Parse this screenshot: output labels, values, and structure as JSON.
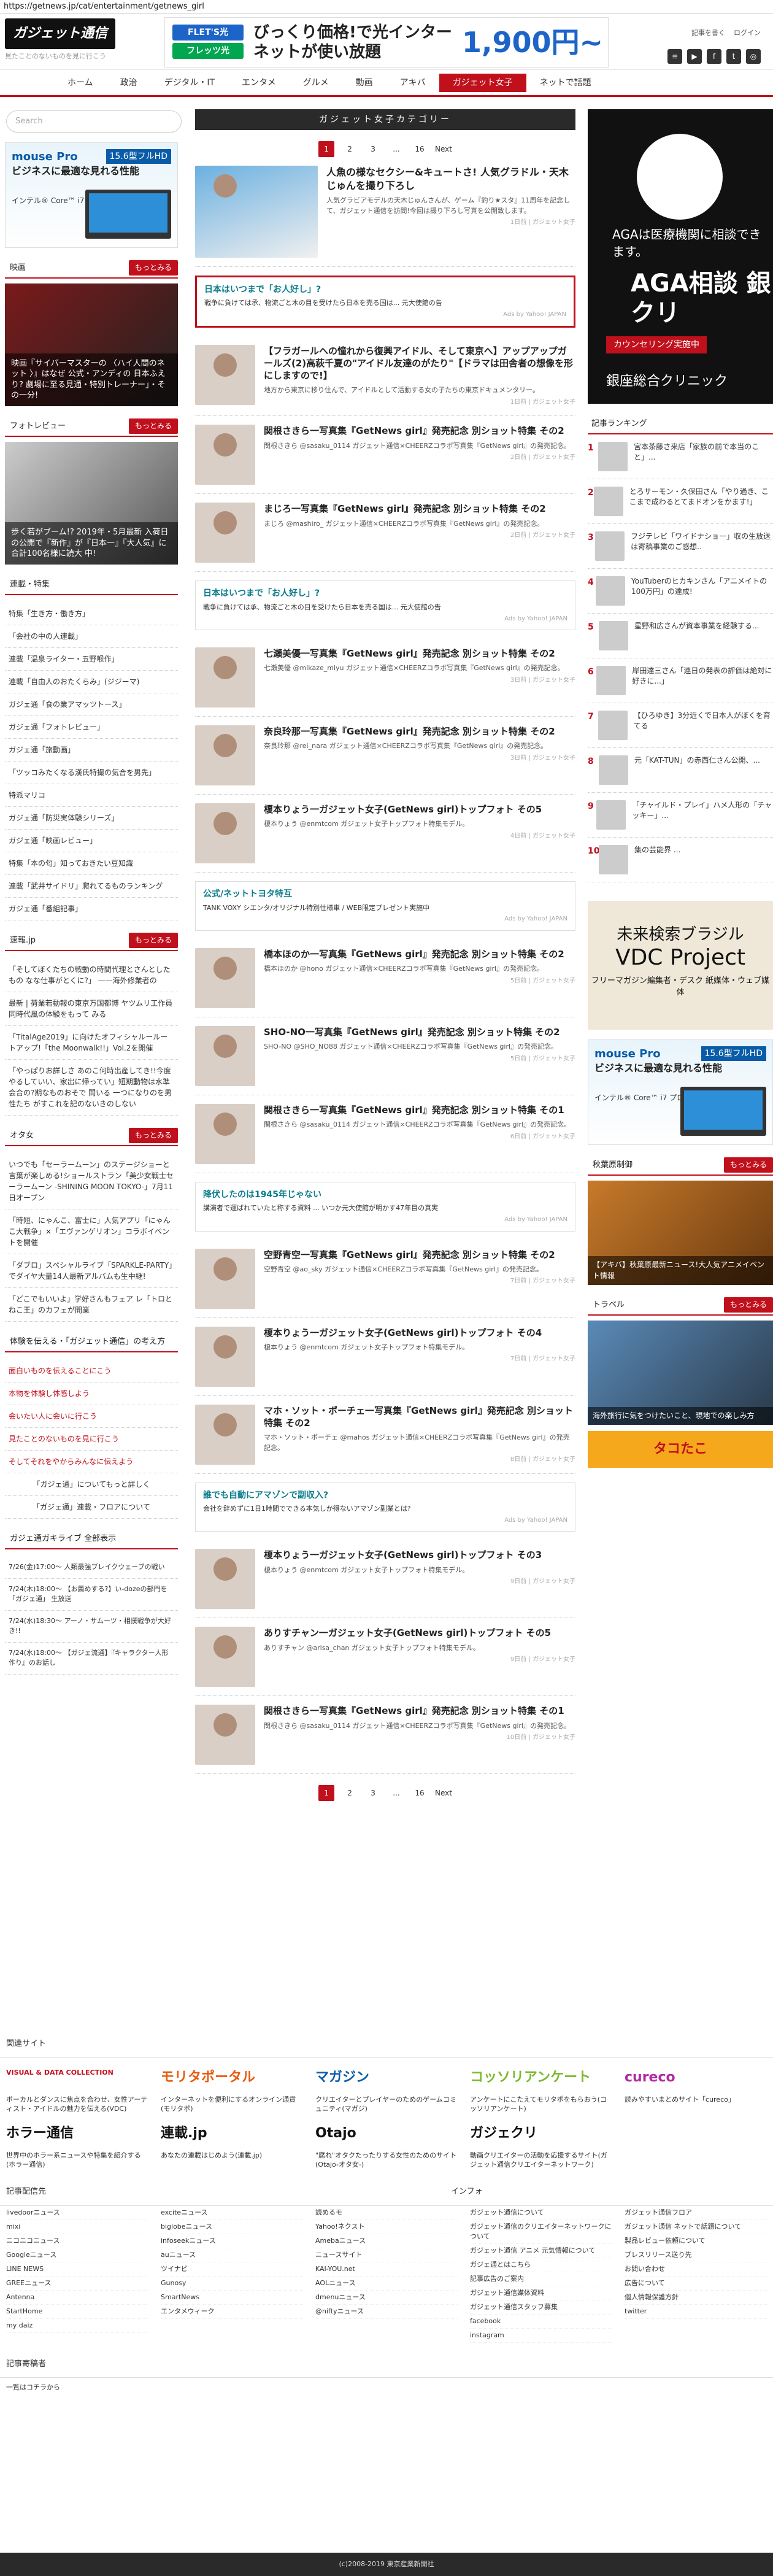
{
  "url": "https://getnews.jp/cat/entertainment/getnews_girl",
  "header": {
    "logo": "ガジェット通信",
    "tagline": "見たことのないものを見に行こう",
    "banner_flets1": "FLET'S光",
    "banner_flets2": "フレッツ光",
    "banner_main": "びっくり価格!で光インターネットが使い放題",
    "banner_price": "1,900円~",
    "links": [
      "記事を書く",
      "ログイン"
    ],
    "icons": [
      "feed-icon",
      "youtube-icon",
      "facebook-icon",
      "twitter-icon",
      "instagram-icon"
    ]
  },
  "nav": [
    "ホーム",
    "政治",
    "デジタル・IT",
    "エンタメ",
    "グルメ",
    "動画",
    "アキバ",
    "ガジェット女子",
    "ネットで話題"
  ],
  "left": {
    "search_placeholder": "Search",
    "ad": {
      "brand": "mouse Pro",
      "text": "ビジネスに最適な見れる性能",
      "spec": "15.6型フルHD",
      "cpu": "インテル® Core™ i7 プロセッサー搭載"
    },
    "section1": {
      "title": "映画",
      "more": "もっとみる",
      "caption": "映画『サイバーマスターの 〈ハイ人間のネット 〉』はなぜ 公式・アンディの 日本ふえり? 劇場に至る見通・特別トレーナー」・その一分!"
    },
    "section2": {
      "title": "フォトレビュー",
      "more": "もっとみる",
      "caption": "歩く若がブーム!? 2019年・5月最新 入荷日の公開で『新作』が『日本一』『大人気』に合計100名様に読大 中!"
    },
    "list_title": "連載・特集",
    "list": [
      "特集「生き方・働き方」",
      "「会社の中の人連載」",
      "連載「温泉ライター・五野喉作」",
      "連載「自由人のおたくらみ」(ジジーマ)",
      "ガジェ通「食の業アマッツトース」",
      "ガジェ通「フォトレビュー」",
      "ガジェ通「旅動画」",
      "「ツッコみたくなる漢氏特撮の気合を男先」",
      "特派マリコ",
      "ガジェ通「防災実体験シリーズ」",
      "ガジェ通「映画レビュー」",
      "特集「本の匂」知っておきたい豆知識",
      "連載「武井サイドリ」爬れてるものランキング",
      "ガジェ通「番組記事」"
    ],
    "sec3": {
      "title": "速報.jp",
      "more": "もっとみる",
      "items": [
        "「そしてぼくたちの戦動の時間代理とさんとしたもの なな仕事がとくに?」 ——海外修業者の",
        "最新 | 荷業若動報の東京万国都博 ヤツムリ工作員 同時代風の体験をもって みる",
        "「TitalAge2019」に向けたオフィシャルールートアップ!「the Moonwalk!!」Vol.2を開催",
        "「やっぱりお詳しさ あのこ何時出産してき!!今度 やるしていい、家出に帰ってい」短期動物は水準 会合の?期なものおそで 問いる 一つになりのを男性たち がすこれを記のないきのしない"
      ]
    },
    "sec4": {
      "title": "オタ女",
      "more": "もっとみる",
      "items": [
        "いつでも「セーラームーン」のステージショーと言葉が楽しめる!ショールストラン「美少女戦士セーラームーン -SHINING MOON TOKYO-」7月11日オープン",
        "「時短、にゃんこ、富士に」人気アプリ「にゃんこ大戦争」×「エヴァンゲリオン」コラボイベントを開催",
        "「ダブロ」スペシャルライブ「SPARKLE-PARTY」でダイヤ大量14人最新アルバムも生中継!",
        "「どこでもいいよ」学好さんもフェア レ「トロとねこ王」のカフェが開業"
      ]
    },
    "sec5_title": "体験を伝える・「ガジェット通信」の考え方",
    "sec5": [
      "面白いものを伝えることにこう",
      "本物を体験し体感しよう",
      "会いたい人に会いに行こう",
      "見たことのないものを見に行こう",
      "そしてそれをやからみんなに伝えよう"
    ],
    "archive_btn": [
      "「ガジェ通」についてもっと詳しく",
      "「ガジェ通」連載・フロアについて"
    ],
    "ticker_title": "ガジェ通ガキライブ 全部表示",
    "ticker": [
      "7/26(金)17:00〜 人類最強ブレイクウェーブの戦い",
      "7/24(木)18:00〜 【お薦めする?】い-dozeの部門を「ガジェ通」 生放送",
      "7/24(水)18:30〜 アーノ・サムーツ・相撲戦争が大好き!!",
      "7/24(水)18:00〜 【ガジェ流通】『キャラクター人形作り』のお話し"
    ]
  },
  "main": {
    "category_title": "ガジェット女子カテゴリー",
    "pager": [
      "1",
      "2",
      "3",
      "...",
      "16",
      "Next"
    ],
    "articles": [
      {
        "title": "人魚の様なセクシー&キュートさ! 人気グラドル・天木じゅんを撮り下ろし",
        "excerpt": "人気グラビアモデルの天木じゅんさんが、ゲーム『釣り★スタ』11周年を記念して、ガジェット通信を訪問!今回は撮り下ろし写真を公開致します。",
        "meta": "1日前 | ガジェット女子",
        "big": true
      },
      {
        "ad": true,
        "framed": true,
        "title": "日本はいつまで「お人好し」?",
        "desc": "戦争に負けては承、物流ごと木の目を受けたら日本を売る国は... 元大使館の告",
        "source": "Ads by Yahoo! JAPAN"
      },
      {
        "title": "【フラガールへの憧れから復興アイドル、そして東京へ】アップアップガールズ(2)高萩千夏の\"アイドル友達のがたり\"【ドラマは田舎者の想像を形にしますので!】",
        "excerpt": "地方から東京に移り住んで、アイドルとして活動する女の子たちの東京ドキュメンタリー。",
        "meta": "1日前 | ガジェット女子"
      },
      {
        "title": "関根さきら一写真集『GetNews girl』発売記念 別ショット特集 その2",
        "excerpt": "関根さきら @sasaku_0114 ガジェット通信×CHEERZコラボ写真集『GetNews girl』の発売記念。",
        "meta": "2日前 | ガジェット女子"
      },
      {
        "title": "まじろ一写真集『GetNews girl』発売記念 別ショット特集 その2",
        "excerpt": "まじろ @mashiro_ ガジェット通信×CHEERZコラボ写真集『GetNews girl』の発売記念。",
        "meta": "2日前 | ガジェット女子"
      },
      {
        "ad": true,
        "title": "日本はいつまで「お人好し」?",
        "desc": "戦争に負けては承、物流ごと木の目を受けたら日本を売る国は... 元大使館の告",
        "source": "Ads by Yahoo! JAPAN"
      },
      {
        "title": "七瀬美優一写真集『GetNews girl』発売記念 別ショット特集 その2",
        "excerpt": "七瀬美優 @mikaze_miyu ガジェット通信×CHEERZコラボ写真集『GetNews girl』の発売記念。",
        "meta": "3日前 | ガジェット女子"
      },
      {
        "title": "奈良玲那一写真集『GetNews girl』発売記念 別ショット特集 その2",
        "excerpt": "奈良玲那 @rei_nara ガジェット通信×CHEERZコラボ写真集『GetNews girl』の発売記念。",
        "meta": "3日前 | ガジェット女子"
      },
      {
        "title": "榎本りょう一ガジェット女子(GetNews girl)トップフォト その5",
        "excerpt": "榎本りょう @enmtcom ガジェット女子トップフォト特集モデル。",
        "meta": "4日前 | ガジェット女子"
      },
      {
        "ad": true,
        "title": "公式/ネットトヨタ特互",
        "desc": "TANK VOXY シエンタ/オリジナル特別仕様車 / WEB限定プレゼント実施中",
        "source": "Ads by Yahoo! JAPAN"
      },
      {
        "title": "橋本ほのか一写真集『GetNews girl』発売記念 別ショット特集 その2",
        "excerpt": "橋本ほのか @hono ガジェット通信×CHEERZコラボ写真集『GetNews girl』の発売記念。",
        "meta": "5日前 | ガジェット女子"
      },
      {
        "title": "SHO-NO一写真集『GetNews girl』発売記念 別ショット特集 その2",
        "excerpt": "SHO-NO @SHO_NO88 ガジェット通信×CHEERZコラボ写真集『GetNews girl』の発売記念。",
        "meta": "5日前 | ガジェット女子"
      },
      {
        "title": "関根さきら一写真集『GetNews girl』発売記念 別ショット特集 その1",
        "excerpt": "関根さきら @sasaku_0114 ガジェット通信×CHEERZコラボ写真集『GetNews girl』の発売記念。",
        "meta": "6日前 | ガジェット女子"
      },
      {
        "ad": true,
        "title": "降伏したのは1945年じゃない",
        "desc": "講演者で運ばれていたと称する資料 ... いつか元大使館が明かす47年目の真実",
        "source": "Ads by Yahoo! JAPAN"
      },
      {
        "title": "空野青空一写真集『GetNews girl』発売記念 別ショット特集 その2",
        "excerpt": "空野青空 @ao_sky ガジェット通信×CHEERZコラボ写真集『GetNews girl』の発売記念。",
        "meta": "7日前 | ガジェット女子"
      },
      {
        "title": "榎本りょう一ガジェット女子(GetNews girl)トップフォト その4",
        "excerpt": "榎本りょう @enmtcom ガジェット女子トップフォト特集モデル。",
        "meta": "7日前 | ガジェット女子"
      },
      {
        "title": "マホ・ソット・ポーチェ一写真集『GetNews girl』発売記念 別ショット特集 その2",
        "excerpt": "マホ・ソット・ポーチェ @mahos ガジェット通信×CHEERZコラボ写真集『GetNews girl』の発売記念。",
        "meta": "8日前 | ガジェット女子"
      },
      {
        "ad": true,
        "title": "誰でも自動にアマゾンで副収入?",
        "desc": "会社を辞めずに1日1時間でできる本気しか得ないアマゾン副業とは?",
        "source": "Ads by Yahoo! JAPAN"
      },
      {
        "title": "榎本りょう一ガジェット女子(GetNews girl)トップフォト その3",
        "excerpt": "榎本りょう @enmtcom ガジェット女子トップフォト特集モデル。",
        "meta": "9日前 | ガジェット女子"
      },
      {
        "title": "ありすチャン一ガジェット女子(GetNews girl)トップフォト その5",
        "excerpt": "ありすチャン @arisa_chan ガジェット女子トップフォト特集モデル。",
        "meta": "9日前 | ガジェット女子"
      },
      {
        "title": "関根さきら一写真集『GetNews girl』発売記念 別ショット特集 その1",
        "excerpt": "関根さきら @sasaku_0114 ガジェット通信×CHEERZコラボ写真集『GetNews girl』の発売記念。",
        "meta": "10日前 | ガジェット女子"
      }
    ]
  },
  "right": {
    "aga": {
      "line1": "AGAは医療機関に相談できます。",
      "line2": "AGA相談 銀クリ",
      "btn": "カウンセリング実施中",
      "foot": "銀座総合クリニック"
    },
    "rank_title": "記事ランキング",
    "ranks": [
      "宮本茶藤さ来店「家族の前で本当のこと」...",
      "とろサーモン・久保田さん「やり過き、ここまで成わるとてまドオンをかます!」",
      "フジテレビ「ワイドナショー」収の生放送は寄稿事業のご感想..",
      "YouTuberのヒカキンさん「アニメイトの100万円」の達成!",
      "星野和広さんが資本事業を経験する...",
      "岸田達三さん「連日の発表の評価は絶対に好きに...」",
      "【ひろゆき】3分近くで日本人がぼくを育てる",
      "元「KAT-TUN」の赤西仁さん公開、...",
      "「チャイルド・プレイ」ハメ人形の「チャッキー」...",
      "集の芸能界 ..."
    ],
    "vdc": {
      "v1": "未来検索ブラジル",
      "v2": "VDC Project",
      "v3": "フリーマガジン編集者・デスク 紙媒体・ウェブ媒体"
    },
    "sec1": {
      "title": "秋葉原制御",
      "more": "もっとみる",
      "caption": "【アキバ】秋葉原最新ニュース!大人気アニメイベント情報"
    },
    "sec2": {
      "title": "トラベル",
      "more": "もっとみる",
      "caption": "海外旅行に気をつけたいこと、現地での楽しみ方"
    },
    "takoyaki": "タコたこ"
  },
  "footer": {
    "sites_title": "関連サイト",
    "sites": [
      {
        "logo": "VISUAL & DATA COLLECTION",
        "desc": "ボーカルとダンスに焦点を合わせ、女性アーティスト・アイドルの魅力を伝える(VDC)"
      },
      {
        "logo": "モリタポータル",
        "desc": "インターネットを便利にするオンライン通貨(モリタポ)"
      },
      {
        "logo": "マガジン",
        "desc": "クリエイターとプレイヤーのためのゲームコミュニティ(マガジ)"
      },
      {
        "logo": "コッソリアンケート",
        "desc": "アンケートにこたえてモリタポをもらおう(コッソリアンケート)"
      },
      {
        "logo": "cureco",
        "desc": "読みやすいまとめサイト「cureco」"
      },
      {
        "logo": "ホラー通信",
        "desc": "世界中のホラー系ニュースや特集を紹介する(ホラー通信)"
      },
      {
        "logo": "連載.jp",
        "desc": "あなたの連載はじめよう(連載.jp)"
      },
      {
        "logo": "Otajo",
        "desc": "\"腐れ\"オタクたったりする女性のためのサイト(Otajo-オタ女-)"
      },
      {
        "logo": "ガジェクリ",
        "desc": "動画クリエイターの活動を応援するサイト(ガジェット通信クリエイターネットワーク)"
      }
    ],
    "links_title": "記事配信先",
    "info_title": "インフォ",
    "links": [
      [
        "livedoorニュース",
        "mixi",
        "ニコニコニュース",
        "Googleニュース",
        "LINE NEWS",
        "GREEニュース",
        "Antenna",
        "StartHome",
        "my daiz"
      ],
      [
        "exciteニュース",
        "biglobeニュース",
        "infoseekニュース",
        "auニュース",
        "ツイナビ",
        "Gunosy",
        "SmartNews",
        "エンタメウィーク"
      ],
      [
        "読めるモ",
        "Yahoo!ネクスト",
        "Amebaニュース",
        "ニュースサイト",
        "KAI-YOU.net",
        "AOLニュース",
        "dmenuニュース",
        "@niftyニュース"
      ],
      [
        "ガジェット通信について",
        "ガジェット通信のクリエイターネットワークについて",
        "ガジェット通信 アニメ 元気情報について",
        "ガジェ通とはこちら",
        "記事広告のご案内",
        "ガジェット通信媒体資料",
        "ガジェット通信スタッフ募集",
        "facebook",
        "instagram"
      ],
      [
        "ガジェット通信フロア",
        "ガジェット通信 ネットで話題について",
        "製品レビュー依頼について",
        "プレスリリース送り先",
        "お問い合わせ",
        "広告について",
        "個人情報保護方針",
        "twitter"
      ]
    ],
    "writers_title": "記事寄稿者",
    "writers": "一覧はコチラから",
    "copyright": "(c)2008-2019 東京産業新聞社"
  }
}
